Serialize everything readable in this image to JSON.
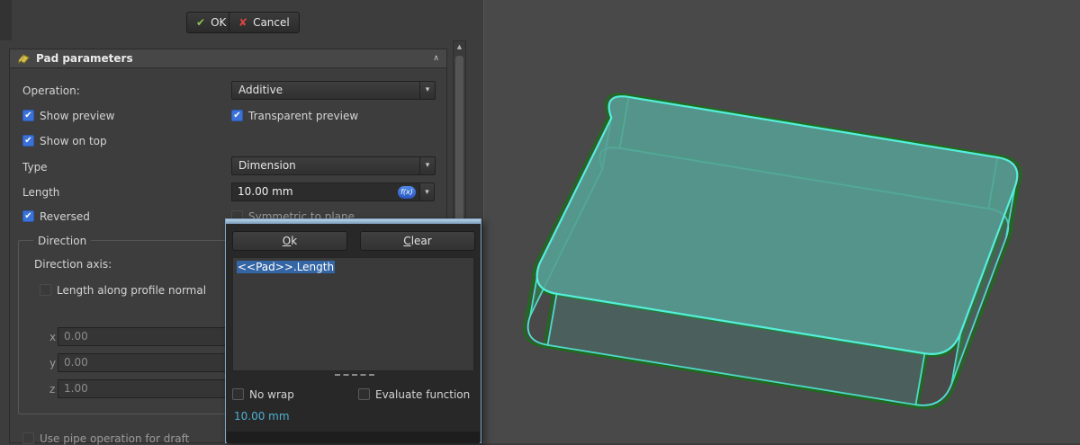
{
  "toolbar": {
    "ok_label": "OK",
    "cancel_label": "Cancel"
  },
  "panel": {
    "title": "Pad parameters",
    "operation": {
      "label": "Operation:",
      "value": "Additive"
    },
    "show_preview": "Show preview",
    "transparent_preview": "Transparent preview",
    "show_on_top": "Show on top",
    "type": {
      "label": "Type",
      "value": "Dimension"
    },
    "length": {
      "label": "Length",
      "value": "10.00 mm",
      "fx": "f(x)"
    },
    "reversed": "Reversed",
    "symmetric": "Symmetric to plane",
    "direction": {
      "group_label": "Direction",
      "axis_label": "Direction axis:",
      "along_normal": "Length along profile normal",
      "x_label": "x",
      "x_value": "0.00",
      "y_label": "y",
      "y_value": "0.00",
      "z_label": "z",
      "z_value": "1.00"
    },
    "use_pipe": "Use pipe operation for draft"
  },
  "dialog": {
    "ok_accel": "O",
    "ok_rest": "k",
    "clear_accel": "C",
    "clear_rest": "lear",
    "expression": "<<Pad>>.Length",
    "no_wrap": "No wrap",
    "evaluate_function": "Evaluate function",
    "result": "10.00 mm"
  },
  "icons": {
    "ok_check": "✔",
    "cancel_cross": "✘",
    "cb_check": "✔",
    "chevron_up": "∧",
    "chevron_down": "▾",
    "scroll_up": "▲"
  },
  "colors": {
    "accent_blue": "#3a72d8",
    "highlight_cyan": "#54efdb",
    "sketch_green": "#1e6b1e",
    "selection_blue": "#3465a4",
    "face_teal": "#4f8e86"
  }
}
